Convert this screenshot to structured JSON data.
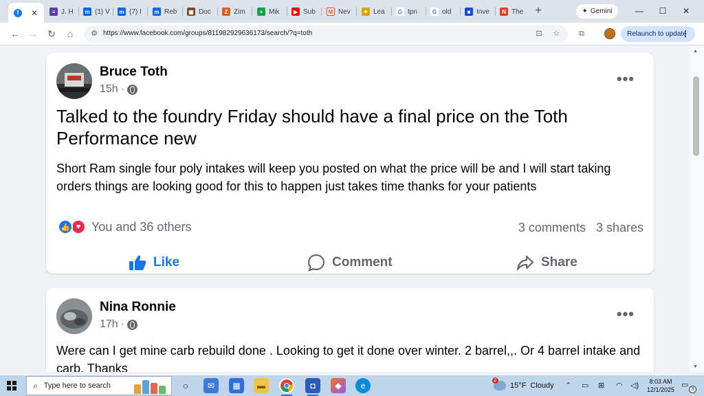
{
  "browser": {
    "tabs": [
      {
        "label": "",
        "favicon": "facebook-icon",
        "color": "#1877f2",
        "active": true
      },
      {
        "label": "J. H",
        "favicon": "doc-icon",
        "color": "#5b3ea8"
      },
      {
        "label": "(1) V",
        "favicon": "meta-icon",
        "color": "#0668e1"
      },
      {
        "label": "(7) I",
        "favicon": "meta-icon",
        "color": "#0668e1"
      },
      {
        "label": "Reb",
        "favicon": "meta-icon",
        "color": "#0668e1"
      },
      {
        "label": "Doc",
        "favicon": "briefcase-icon",
        "color": "#7a4a1a"
      },
      {
        "label": "Zim",
        "favicon": "shop-icon",
        "color": "#e05a1a"
      },
      {
        "label": "Mik",
        "favicon": "plus-icon",
        "color": "#18a34a"
      },
      {
        "label": "Sub",
        "favicon": "youtube-icon",
        "color": "#ff0000"
      },
      {
        "label": "Nev",
        "favicon": "gmail-icon",
        "color": "#ea4335"
      },
      {
        "label": "Lea",
        "favicon": "leaf-icon",
        "color": "#d9a400"
      },
      {
        "label": "tpn",
        "favicon": "google-icon",
        "color": "#4285f4"
      },
      {
        "label": "old",
        "favicon": "google-icon",
        "color": "#4285f4"
      },
      {
        "label": "Inve",
        "favicon": "camera-icon",
        "color": "#1a4bd6"
      },
      {
        "label": "The",
        "favicon": "news-icon",
        "color": "#e0402a"
      }
    ],
    "new_tab_label": "+",
    "gemini_label": "Gemini",
    "window_controls": {
      "minimize": "—",
      "maximize": "☐",
      "close": "✕"
    },
    "url": "https://www.facebook.com/groups/811982929636173/search/?q=toth",
    "relaunch_label": "Relaunch to update"
  },
  "posts": [
    {
      "author": "Bruce Toth",
      "time": "15h",
      "dot": "·",
      "headline": "Talked to the foundry Friday should have a final price on the Toth Performance new",
      "body": "Short Ram single four poly intakes will keep you posted on what the price will be and I will start taking orders things are looking good for this to happen just takes time thanks for your patients",
      "reactions_text": "You and 36 others",
      "comments": "3 comments",
      "shares": "3 shares",
      "actions": {
        "like": "Like",
        "comment": "Comment",
        "share": "Share"
      },
      "more": "•••"
    },
    {
      "author": "Nina Ronnie",
      "time": "17h",
      "dot": "·",
      "body": "Were can I get mine carb rebuild done . Looking to get it done over winter.  2 barrel,,.  Or 4 barrel intake and carb. Thanks",
      "more": "•••"
    }
  ],
  "taskbar": {
    "search_placeholder": "Type here to search",
    "weather": {
      "temp": "15°F",
      "condition": "Cloudy",
      "badge": "2"
    },
    "time": "8:03 AM",
    "date": "12/1/2025",
    "notification_count": "3"
  },
  "colors": {
    "facebook_blue": "#1b74e4",
    "love_red": "#f02849",
    "text_secondary": "#65676b"
  }
}
